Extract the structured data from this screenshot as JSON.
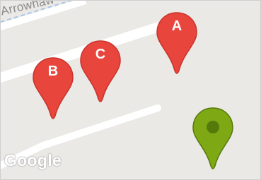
{
  "map": {
    "street_name": "Arrowhaw",
    "attribution_logo": "Google",
    "colors": {
      "land": "#ebe9e6",
      "road": "#ffffff",
      "marker_red": "#e8453c",
      "marker_red_dark": "#c8332b",
      "marker_green": "#7ea814",
      "marker_green_dark": "#567a0a"
    }
  },
  "markers": [
    {
      "label": "A",
      "color": "red"
    },
    {
      "label": "B",
      "color": "red"
    },
    {
      "label": "C",
      "color": "red"
    },
    {
      "label": "",
      "color": "green"
    }
  ]
}
